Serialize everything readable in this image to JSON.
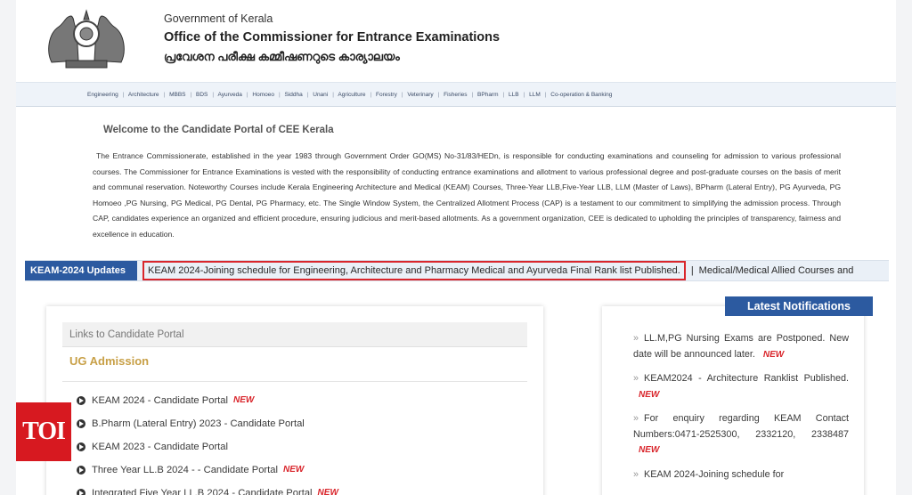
{
  "header": {
    "government": "Government of Kerala",
    "office": "Office of the Commissioner for Entrance Examinations",
    "office_malayalam": "പ്രവേശന പരീക്ഷ കമ്മീഷണറുടെ കാര്യാലയം",
    "emblem_icon": "kerala-emblem-icon"
  },
  "nav": {
    "items": [
      "Engineering",
      "Architecture",
      "MBBS",
      "BDS",
      "Ayurveda",
      "Homoeo",
      "Siddha",
      "Unani",
      "Agriculture",
      "Forestry",
      "Veterinary",
      "Fisheries",
      "BPharm",
      "LLB",
      "LLM",
      "Co-operation & Banking"
    ]
  },
  "welcome": {
    "title": "Welcome to the Candidate Portal of CEE Kerala",
    "text": "The Entrance Commissionerate, established in the year 1983 through Government Order GO(MS) No-31/83/HEDn, is responsible for conducting examinations and counseling for admission to various professional courses. The Commissioner for Entrance Examinations is vested with the responsibility of conducting entrance examinations and allotment to various professional degree and post-graduate courses on the basis of merit and communal reservation. Noteworthy Courses include Kerala Engineering Architecture and Medical (KEAM) Courses, Three-Year LLB,Five-Year LLB, LLM (Master of Laws), BPharm (Lateral Entry), PG Ayurveda, PG Homoeo ,PG Nursing, PG Medical, PG Dental, PG Pharmacy, etc. The Single Window System, the Centralized Allotment Process (CAP) is a testament to our commitment to simplifying the admission process. Through CAP, candidates experience an organized and efficient procedure, ensuring judicious and merit-based allotments. As a government organization, CEE is dedicated to upholding the principles of transparency, fairness and excellence in education."
  },
  "updates": {
    "label": "KEAM-2024 Updates",
    "highlighted": "KEAM 2024-Joining schedule for Engineering, Architecture and Pharmacy  Medical and Ayurveda Final Rank list Published.",
    "separator": "|",
    "next": "Medical/Medical Allied Courses and"
  },
  "links": {
    "header": "Links to Candidate Portal",
    "section_title": "UG Admission",
    "new_label": "NEW",
    "items": [
      {
        "label": "KEAM 2024 - Candidate Portal",
        "new": true
      },
      {
        "label": "B.Pharm (Lateral Entry) 2023 - Candidate Portal",
        "new": false
      },
      {
        "label": "KEAM 2023 - Candidate Portal",
        "new": false
      },
      {
        "label": "Three Year LL.B 2024 - - Candidate Portal",
        "new": true
      },
      {
        "label": "Integrated Five Year LL.B 2024 - Candidate Portal",
        "new": true
      }
    ]
  },
  "notifications": {
    "title": "Latest Notifications",
    "items": [
      {
        "text": "LL.M,PG Nursing Exams are Postponed. New date will be announced later.",
        "new": true
      },
      {
        "text": "KEAM2024 - Architecture Ranklist Published.",
        "new": true
      },
      {
        "text": "For enquiry regarding KEAM Contact Numbers:0471-2525300, 2332120, 2338487",
        "new": true
      },
      {
        "text": "KEAM 2024-Joining schedule for",
        "new": false
      }
    ]
  },
  "watermark": {
    "logo_text": "TOI"
  }
}
